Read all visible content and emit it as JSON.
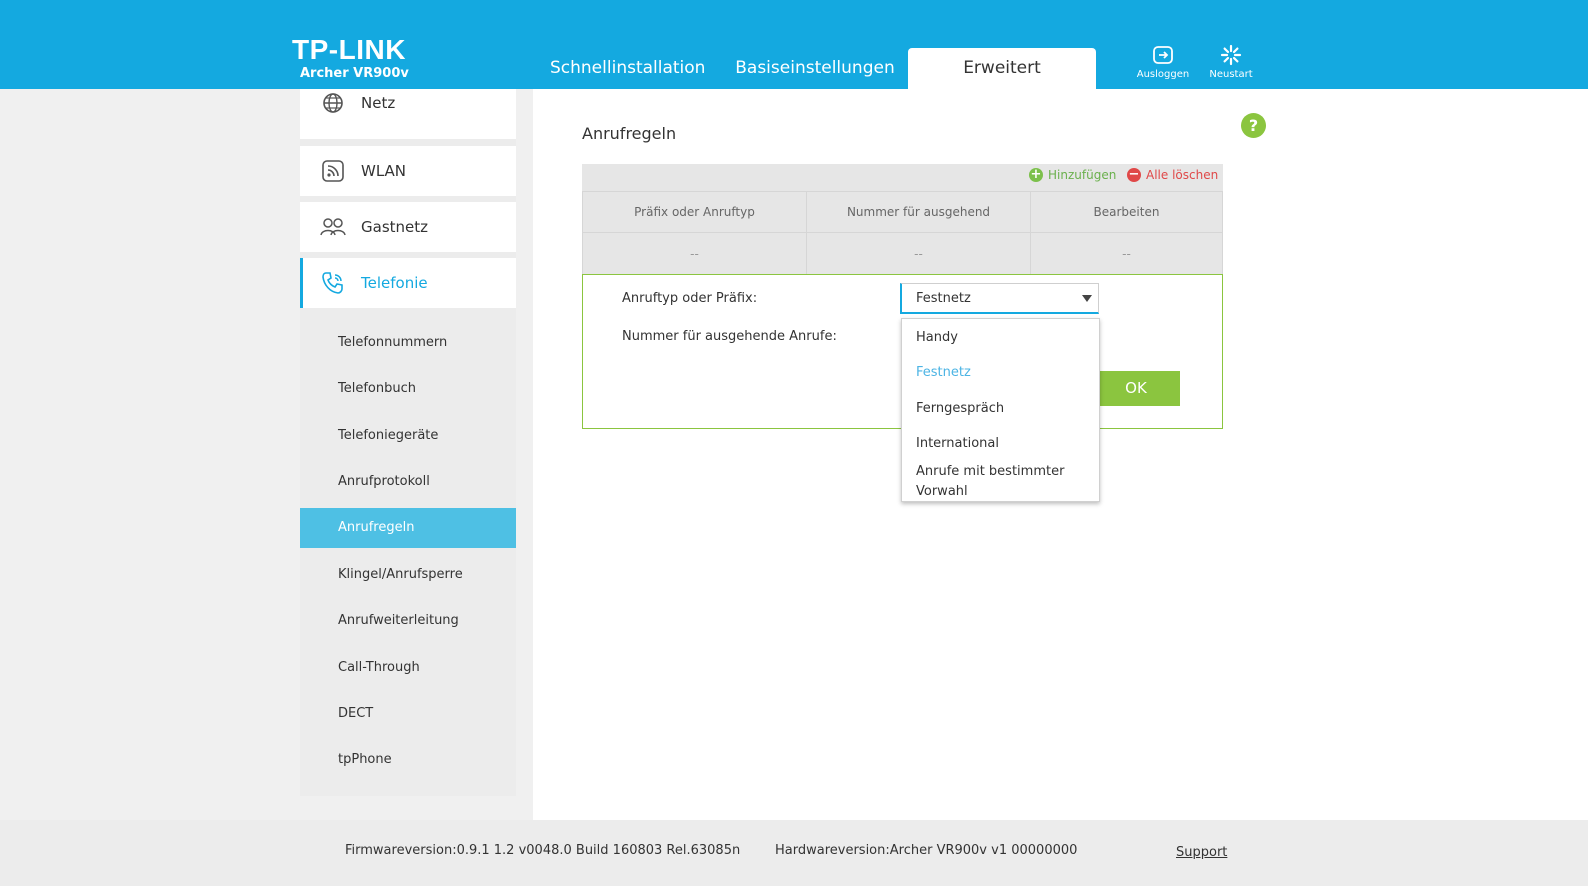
{
  "header": {
    "brand": "TP-LINK",
    "model": "Archer VR900v",
    "tabs": [
      {
        "label": "Schnellinstallation"
      },
      {
        "label": "Basiseinstellungen"
      },
      {
        "label": "Erweitert"
      }
    ],
    "buttons": [
      {
        "label": "Ausloggen",
        "icon": "logout-icon"
      },
      {
        "label": "Neustart",
        "icon": "reboot-icon"
      }
    ],
    "colors": {
      "primary": "#14a9e0",
      "accent_green": "#8bc53f",
      "danger": "#e04848"
    }
  },
  "sidebar": {
    "sections": [
      {
        "label": "Netz",
        "icon": "globe-icon"
      },
      {
        "label": "WLAN",
        "icon": "wifi-icon"
      },
      {
        "label": "Gastnetz",
        "icon": "guest-users-icon"
      },
      {
        "label": "Telefonie",
        "icon": "phone-icon"
      }
    ],
    "sub_items": [
      {
        "label": "Telefonnummern"
      },
      {
        "label": "Telefonbuch"
      },
      {
        "label": "Telefoniegeräte"
      },
      {
        "label": "Anrufprotokoll"
      },
      {
        "label": "Anrufregeln"
      },
      {
        "label": "Klingel/Anrufsperre"
      },
      {
        "label": "Anrufweiterleitung"
      },
      {
        "label": "Call-Through"
      },
      {
        "label": "DECT"
      },
      {
        "label": "tpPhone"
      }
    ]
  },
  "main": {
    "title": "Anrufregeln",
    "help": "?",
    "toolbar": {
      "add_label": "Hinzufügen",
      "delete_all_label": "Alle löschen"
    },
    "table": {
      "columns": [
        "Präfix oder Anruftyp",
        "Nummer für ausgehend",
        "Bearbeiten"
      ],
      "rows": [
        [
          "--",
          "--",
          "--"
        ]
      ]
    },
    "form": {
      "type_label": "Anruftyp oder Präfix:",
      "number_label": "Nummer für ausgehende Anrufe:",
      "selected_value": "Festnetz",
      "options": [
        "Handy",
        "Festnetz",
        "Ferngespräch",
        "International",
        "Anrufe mit bestimmter Vorwahl"
      ],
      "ok_label": "OK"
    }
  },
  "footer": {
    "firmware": "Firmwareversion:0.9.1 1.2 v0048.0 Build 160803 Rel.63085n",
    "hardware": "Hardwareversion:Archer VR900v v1 00000000",
    "support": "Support"
  }
}
